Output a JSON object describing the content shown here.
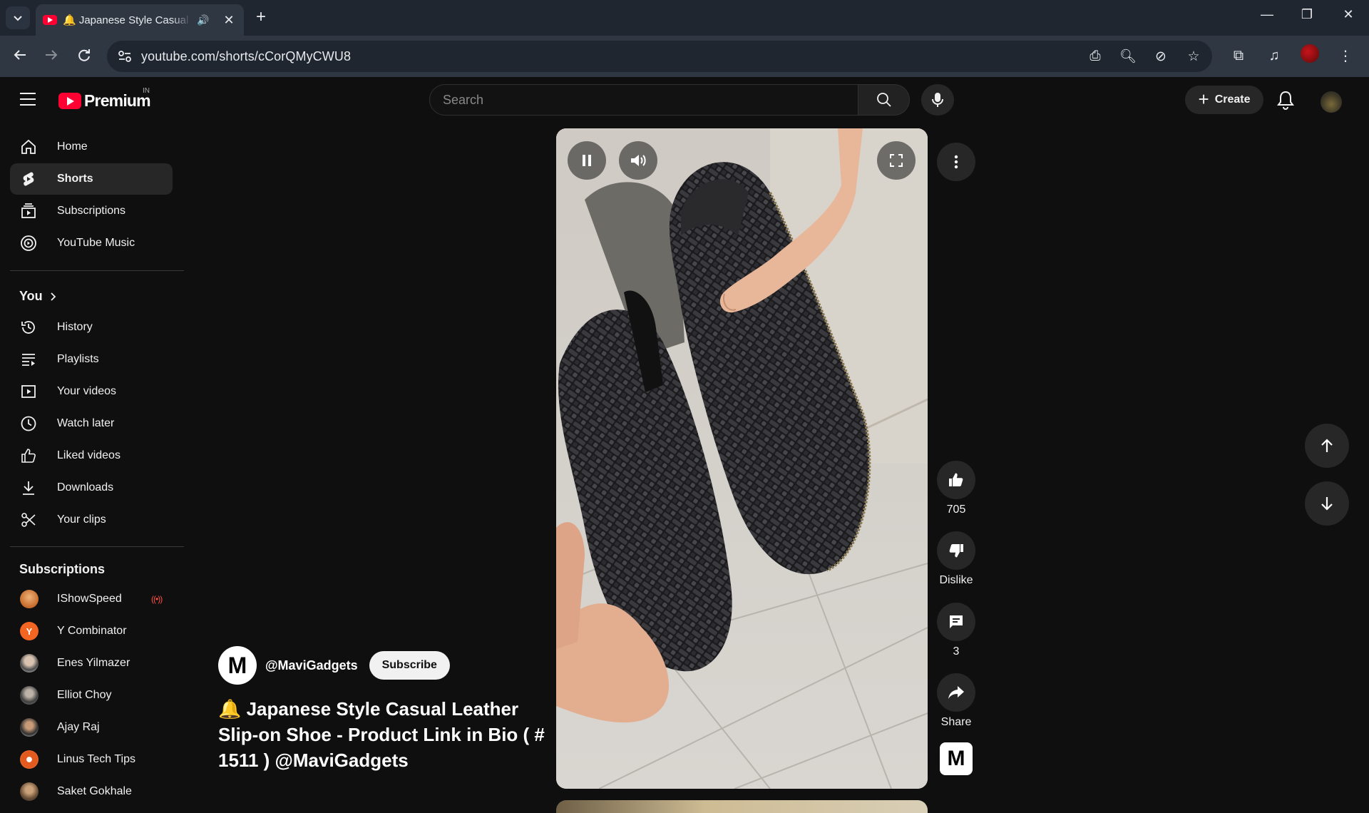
{
  "browser": {
    "tab_title": "🔔 Japanese Style Casual Leather Slip-on Shoe",
    "url": "youtube.com/shorts/cCorQMyCWU8",
    "new_tab_symbol": "+",
    "close_symbol": "✕",
    "window_controls": {
      "minimize": "—",
      "restore": "❐",
      "close": "✕"
    }
  },
  "masthead": {
    "brand": "Premium",
    "region": "IN",
    "search_placeholder": "Search",
    "create_label": "Create",
    "create_symbol": "+"
  },
  "sidebar": {
    "main": [
      {
        "label": "Home",
        "icon": "home-icon"
      },
      {
        "label": "Shorts",
        "icon": "shorts-icon",
        "active": true
      },
      {
        "label": "Subscriptions",
        "icon": "subscriptions-icon"
      },
      {
        "label": "YouTube Music",
        "icon": "youtube-music-icon"
      }
    ],
    "you_title": "You",
    "you": [
      {
        "label": "History",
        "icon": "history-icon"
      },
      {
        "label": "Playlists",
        "icon": "playlists-icon"
      },
      {
        "label": "Your videos",
        "icon": "your-videos-icon"
      },
      {
        "label": "Watch later",
        "icon": "watch-later-icon"
      },
      {
        "label": "Liked videos",
        "icon": "liked-videos-icon"
      },
      {
        "label": "Downloads",
        "icon": "downloads-icon"
      },
      {
        "label": "Your clips",
        "icon": "scissors-icon"
      }
    ],
    "subscriptions_title": "Subscriptions",
    "subscriptions": [
      {
        "label": "IShowSpeed",
        "live": true,
        "color": "#c56a2a"
      },
      {
        "label": "Y Combinator",
        "live": false,
        "color": "#f26522"
      },
      {
        "label": "Enes Yilmazer",
        "live": false,
        "color": "#8a7f78"
      },
      {
        "label": "Elliot Choy",
        "live": false,
        "color": "#5b5b5b"
      },
      {
        "label": "Ajay Raj",
        "live": false,
        "color": "#7b5a45"
      },
      {
        "label": "Linus Tech Tips",
        "live": false,
        "color": "#e35a1f"
      },
      {
        "label": "Saket Gokhale",
        "live": false,
        "color": "#9b7b5a"
      }
    ],
    "live_symbol": "((•))"
  },
  "short": {
    "channel_handle": "@MaviGadgets",
    "channel_initial": "M",
    "subscribe_label": "Subscribe",
    "title": "🔔 Japanese Style Casual Leather Slip-on Shoe - Product Link in Bio ( # 1511 ) @MaviGadgets",
    "likes": "705",
    "dislike_label": "Dislike",
    "comments": "3",
    "share_label": "Share"
  },
  "colors": {
    "background": "#0f0f0f",
    "surface": "#272727",
    "brand_red": "#ff0033",
    "chrome_dark": "#1f2630",
    "chrome_toolbar": "#2f3743"
  }
}
